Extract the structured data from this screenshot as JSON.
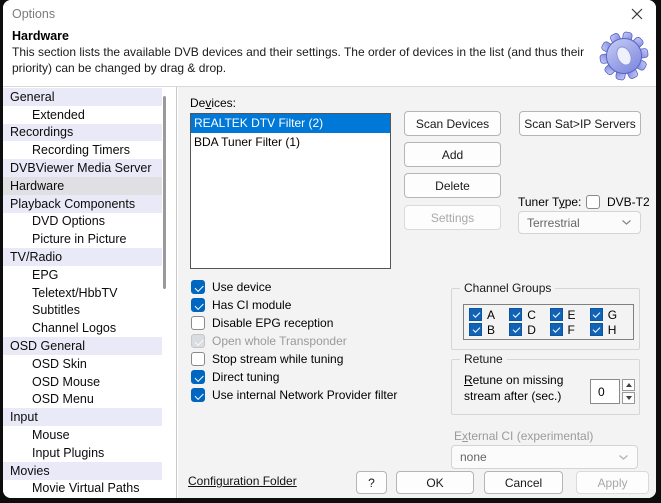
{
  "window": {
    "title": "Options"
  },
  "header": {
    "title": "Hardware",
    "description": "This section lists the available DVB devices and their settings. The order of devices in the list (and thus their priority) can be changed by drag & drop."
  },
  "sidebar": {
    "items": [
      {
        "label": "General",
        "level": 0,
        "group": true,
        "selected": false
      },
      {
        "label": "Extended",
        "level": 1,
        "group": false,
        "selected": false
      },
      {
        "label": "Recordings",
        "level": 0,
        "group": true,
        "selected": false
      },
      {
        "label": "Recording Timers",
        "level": 1,
        "group": false,
        "selected": false
      },
      {
        "label": "DVBViewer Media Server",
        "level": 0,
        "group": true,
        "selected": false
      },
      {
        "label": "Hardware",
        "level": 0,
        "group": false,
        "selected": true
      },
      {
        "label": "Playback Components",
        "level": 0,
        "group": true,
        "selected": false
      },
      {
        "label": "DVD Options",
        "level": 1,
        "group": false,
        "selected": false
      },
      {
        "label": "Picture in Picture",
        "level": 1,
        "group": false,
        "selected": false
      },
      {
        "label": "TV/Radio",
        "level": 0,
        "group": true,
        "selected": false
      },
      {
        "label": "EPG",
        "level": 1,
        "group": false,
        "selected": false
      },
      {
        "label": "Teletext/HbbTV",
        "level": 1,
        "group": false,
        "selected": false
      },
      {
        "label": "Subtitles",
        "level": 1,
        "group": false,
        "selected": false
      },
      {
        "label": "Channel Logos",
        "level": 1,
        "group": false,
        "selected": false
      },
      {
        "label": "OSD General",
        "level": 0,
        "group": true,
        "selected": false
      },
      {
        "label": "OSD Skin",
        "level": 1,
        "group": false,
        "selected": false
      },
      {
        "label": "OSD Mouse",
        "level": 1,
        "group": false,
        "selected": false
      },
      {
        "label": "OSD Menu",
        "level": 1,
        "group": false,
        "selected": false
      },
      {
        "label": "Input",
        "level": 0,
        "group": true,
        "selected": false
      },
      {
        "label": "Mouse",
        "level": 1,
        "group": false,
        "selected": false
      },
      {
        "label": "Input Plugins",
        "level": 1,
        "group": false,
        "selected": false
      },
      {
        "label": "Movies",
        "level": 0,
        "group": true,
        "selected": false
      },
      {
        "label": "Movie Virtual Paths",
        "level": 1,
        "group": false,
        "selected": false
      }
    ]
  },
  "devices": {
    "label": {
      "pre": "De",
      "mn": "v",
      "post": "ices:"
    },
    "items": [
      {
        "name": "REALTEK DTV Filter (2)",
        "selected": true
      },
      {
        "name": "BDA Tuner Filter (1)",
        "selected": false
      }
    ]
  },
  "action_buttons": {
    "scan_devices": "Scan Devices",
    "scan_satip": "Scan Sat>IP Servers",
    "add": "Add",
    "delete": "Delete",
    "settings": "Settings"
  },
  "tuner_type": {
    "label": {
      "pre": "Tuner T",
      "mn": "y",
      "post": "pe:"
    },
    "checkbox_label": "DVB-T2",
    "checkbox_checked": false,
    "dropdown_value": "Terrestrial"
  },
  "device_options": [
    {
      "label": "Use device",
      "checked": true,
      "disabled": false
    },
    {
      "label": "Has CI module",
      "checked": true,
      "disabled": false
    },
    {
      "label": "Disable EPG reception",
      "checked": false,
      "disabled": false
    },
    {
      "label": "Open whole Transponder",
      "checked": true,
      "disabled": true
    },
    {
      "label": "Stop stream while tuning",
      "checked": false,
      "disabled": false
    },
    {
      "label": "Direct tuning",
      "checked": true,
      "disabled": false
    },
    {
      "label": "Use internal Network Provider filter",
      "checked": true,
      "disabled": false
    }
  ],
  "channel_groups": {
    "title": "Channel Groups",
    "items": [
      {
        "label": "A",
        "checked": true
      },
      {
        "label": "B",
        "checked": true
      },
      {
        "label": "C",
        "checked": true
      },
      {
        "label": "D",
        "checked": true
      },
      {
        "label": "E",
        "checked": true
      },
      {
        "label": "F",
        "checked": true
      },
      {
        "label": "G",
        "checked": true
      },
      {
        "label": "H",
        "checked": true
      }
    ]
  },
  "retune": {
    "title": "Retune",
    "label": {
      "pre": "",
      "mn": "R",
      "post": "etune on missing stream after (sec.)"
    },
    "value": "0"
  },
  "external_ci": {
    "label": {
      "pre": "E",
      "mn": "x",
      "post": "ternal CI (experimental)"
    },
    "value": "none"
  },
  "footer": {
    "config_folder": "Configuration Folder",
    "help": "?",
    "ok": "OK",
    "cancel": "Cancel",
    "apply": "Apply"
  },
  "colors": {
    "selection_blue": "#0078d7",
    "checkbox_blue": "#0067c0",
    "channel_checkbox_blue": "#1063b6",
    "sidebar_group_bg": "#e9e9f8",
    "sidebar_selected_bg": "#e0e0e4",
    "panel_bg": "#f3f3f3",
    "window_bg": "#ffffff",
    "gear_blue": "#8a94e0"
  }
}
